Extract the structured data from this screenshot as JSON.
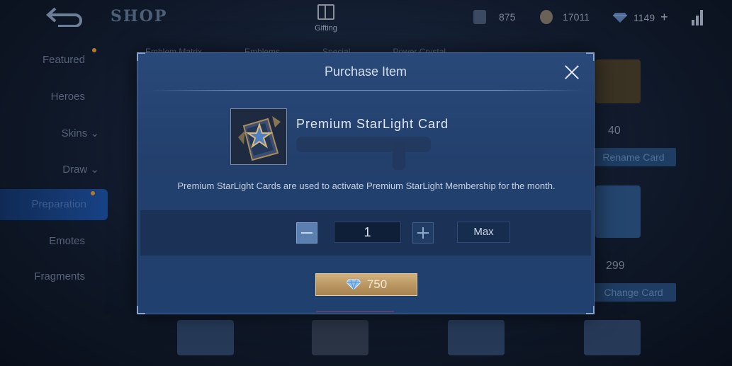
{
  "header": {
    "shop_title": "SHOP",
    "gifting_label": "Gifting",
    "currencies": [
      {
        "name": "tickets",
        "value": "875"
      },
      {
        "name": "battle-points",
        "value": "17011"
      },
      {
        "name": "diamonds",
        "value": "1149"
      }
    ]
  },
  "sidebar": {
    "items": [
      {
        "label": "Featured"
      },
      {
        "label": "Heroes"
      },
      {
        "label": "Skins"
      },
      {
        "label": "Draw"
      },
      {
        "label": "Preparation"
      },
      {
        "label": "Emotes"
      },
      {
        "label": "Fragments"
      }
    ],
    "active": "Preparation"
  },
  "background": {
    "tabs": [
      "Emblem Matrix",
      "Emblems",
      "Special",
      "Power Crystal"
    ],
    "card_values": [
      "40",
      "299"
    ],
    "card_buttons": [
      "Rename Card",
      "Change Card"
    ]
  },
  "modal": {
    "title": "Purchase Item",
    "item_name": "Premium StarLight Card",
    "description": "Premium StarLight Cards are used to activate Premium StarLight Membership for the month.",
    "quantity": "1",
    "max_label": "Max",
    "price": "750"
  },
  "colors": {
    "modal_bg": "#23406d",
    "buy_button": "#b89561",
    "diamond": "#6fa8e8"
  }
}
